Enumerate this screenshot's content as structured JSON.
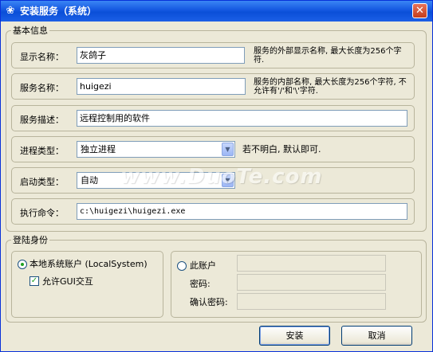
{
  "window": {
    "title": "安装服务（系统）",
    "close_label": "✕"
  },
  "basic_info": {
    "legend": "基本信息",
    "display_name": {
      "label": "显示名称：",
      "value": "灰鸽子",
      "hint": "服务的外部显示名称, 最大长度为256个字符."
    },
    "service_name": {
      "label": "服务名称：",
      "value": "huigezi",
      "hint": "服务的内部名称, 最大长度为256个字符, 不允许有'/'和'\\'字符."
    },
    "description": {
      "label": "服务描述：",
      "value": "远程控制用的软件"
    },
    "process_type": {
      "label": "进程类型：",
      "value": "独立进程",
      "hint": "若不明白, 默认即可."
    },
    "start_type": {
      "label": "启动类型：",
      "value": "自动"
    },
    "exec_command": {
      "label": "执行命令：",
      "value": "c:\\huigezi\\huigezi.exe"
    }
  },
  "logon": {
    "legend": "登陆身份",
    "local_system": {
      "label": "本地系统账户 (LocalSystem)",
      "selected": true
    },
    "allow_gui": {
      "label": "允许GUI交互",
      "checked": true
    },
    "this_account": {
      "label": "此账户",
      "selected": false,
      "value": ""
    },
    "password": {
      "label": "密码:",
      "value": ""
    },
    "confirm_password": {
      "label": "确认密码:",
      "value": ""
    }
  },
  "buttons": {
    "install": "安装",
    "cancel": "取消"
  },
  "watermark": "www.DuoTe.com"
}
